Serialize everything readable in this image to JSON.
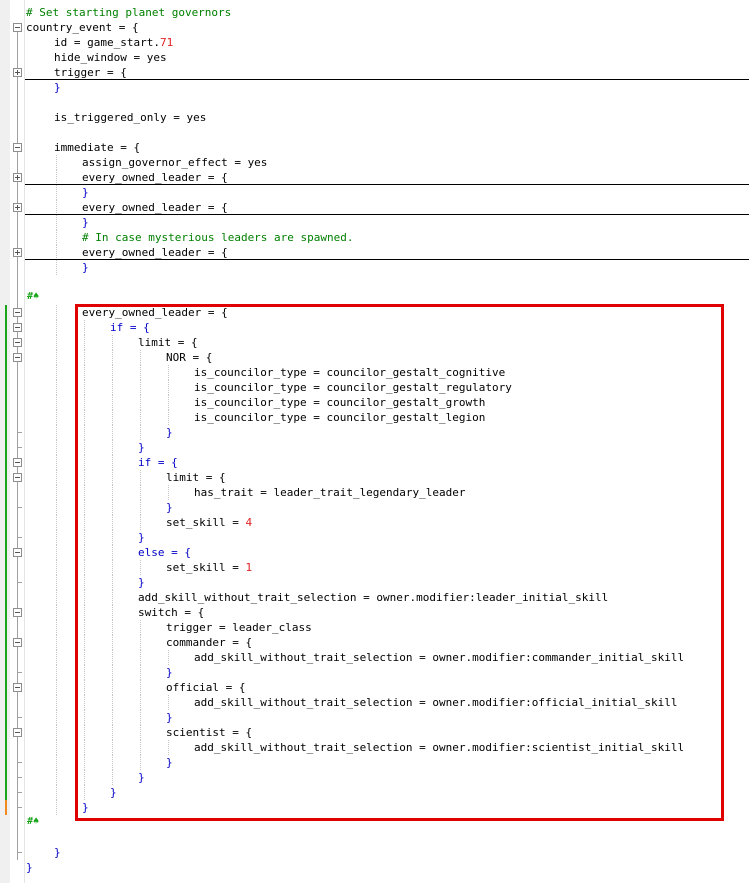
{
  "editor": {
    "lines": [
      {
        "indent": 0,
        "gutter": "none",
        "segments": [
          {
            "text": "# Set starting planet governors",
            "cls": "cmt"
          }
        ]
      },
      {
        "indent": 0,
        "gutter": "fold-open",
        "segments": [
          {
            "text": "country_event = {",
            "cls": "plain"
          }
        ]
      },
      {
        "indent": 1,
        "gutter": "line",
        "segments": [
          {
            "text": "id = game_start.",
            "cls": "plain"
          },
          {
            "text": "71",
            "cls": "num"
          }
        ]
      },
      {
        "indent": 1,
        "gutter": "line",
        "segments": [
          {
            "text": "hide_window = yes",
            "cls": "plain"
          }
        ]
      },
      {
        "indent": 1,
        "gutter": "fold-closed",
        "folded": true,
        "segments": [
          {
            "text": "trigger = {",
            "cls": "plain"
          }
        ]
      },
      {
        "indent": 1,
        "gutter": "line",
        "segments": [
          {
            "text": "}",
            "cls": "kw"
          }
        ]
      },
      {
        "indent": 0,
        "gutter": "line",
        "segments": []
      },
      {
        "indent": 1,
        "gutter": "line",
        "segments": [
          {
            "text": "is_triggered_only = yes",
            "cls": "plain"
          }
        ]
      },
      {
        "indent": 0,
        "gutter": "line",
        "segments": []
      },
      {
        "indent": 1,
        "gutter": "fold-open",
        "segments": [
          {
            "text": "immediate = {",
            "cls": "plain"
          }
        ]
      },
      {
        "indent": 2,
        "gutter": "line",
        "segments": [
          {
            "text": "assign_governor_effect = yes",
            "cls": "plain"
          }
        ]
      },
      {
        "indent": 2,
        "gutter": "fold-closed",
        "folded": true,
        "segments": [
          {
            "text": "every_owned_leader = {",
            "cls": "plain"
          }
        ]
      },
      {
        "indent": 2,
        "gutter": "line",
        "segments": [
          {
            "text": "}",
            "cls": "kw"
          }
        ]
      },
      {
        "indent": 2,
        "gutter": "fold-closed",
        "folded": true,
        "segments": [
          {
            "text": "every_owned_leader = {",
            "cls": "plain"
          }
        ]
      },
      {
        "indent": 2,
        "gutter": "line",
        "segments": [
          {
            "text": "}",
            "cls": "kw"
          }
        ]
      },
      {
        "indent": 2,
        "gutter": "line",
        "segments": [
          {
            "text": "# In case mysterious leaders are spawned.",
            "cls": "cmt"
          }
        ]
      },
      {
        "indent": 2,
        "gutter": "fold-closed",
        "folded": true,
        "segments": [
          {
            "text": "every_owned_leader = {",
            "cls": "plain"
          }
        ]
      },
      {
        "indent": 2,
        "gutter": "line",
        "segments": [
          {
            "text": "}",
            "cls": "kw"
          }
        ]
      },
      {
        "indent": 0,
        "gutter": "line",
        "segments": []
      },
      {
        "indent": 0,
        "gutter": "line",
        "mark": "#♠",
        "segments": []
      },
      {
        "indent": 2,
        "gutter": "fold-open",
        "change": "green",
        "segments": [
          {
            "text": "every_owned_leader = {",
            "cls": "plain"
          }
        ]
      },
      {
        "indent": 3,
        "gutter": "fold-open",
        "change": "green",
        "segments": [
          {
            "text": "if = {",
            "cls": "kw"
          }
        ]
      },
      {
        "indent": 4,
        "gutter": "fold-open",
        "change": "green",
        "segments": [
          {
            "text": "limit = {",
            "cls": "plain"
          }
        ]
      },
      {
        "indent": 5,
        "gutter": "fold-open",
        "change": "green",
        "segments": [
          {
            "text": "NOR = {",
            "cls": "plain"
          }
        ]
      },
      {
        "indent": 6,
        "gutter": "line",
        "change": "green",
        "segments": [
          {
            "text": "is_councilor_type = councilor_gestalt_cognitive",
            "cls": "plain"
          }
        ]
      },
      {
        "indent": 6,
        "gutter": "line",
        "change": "green",
        "segments": [
          {
            "text": "is_councilor_type = councilor_gestalt_regulatory",
            "cls": "plain"
          }
        ]
      },
      {
        "indent": 6,
        "gutter": "line",
        "change": "green",
        "segments": [
          {
            "text": "is_councilor_type = councilor_gestalt_growth",
            "cls": "plain"
          }
        ]
      },
      {
        "indent": 6,
        "gutter": "line",
        "change": "green",
        "segments": [
          {
            "text": "is_councilor_type = councilor_gestalt_legion",
            "cls": "plain"
          }
        ]
      },
      {
        "indent": 5,
        "gutter": "close",
        "change": "green",
        "segments": [
          {
            "text": "}",
            "cls": "kw"
          }
        ]
      },
      {
        "indent": 4,
        "gutter": "close",
        "change": "green",
        "segments": [
          {
            "text": "}",
            "cls": "kw"
          }
        ]
      },
      {
        "indent": 4,
        "gutter": "fold-open",
        "change": "green",
        "segments": [
          {
            "text": "if = {",
            "cls": "kw"
          }
        ]
      },
      {
        "indent": 5,
        "gutter": "fold-open",
        "change": "green",
        "segments": [
          {
            "text": "limit = {",
            "cls": "plain"
          }
        ]
      },
      {
        "indent": 6,
        "gutter": "line",
        "change": "green",
        "segments": [
          {
            "text": "has_trait = leader_trait_legendary_leader",
            "cls": "plain"
          }
        ]
      },
      {
        "indent": 5,
        "gutter": "close",
        "change": "green",
        "segments": [
          {
            "text": "}",
            "cls": "kw"
          }
        ]
      },
      {
        "indent": 5,
        "gutter": "line",
        "change": "green",
        "segments": [
          {
            "text": "set_skill = ",
            "cls": "plain"
          },
          {
            "text": "4",
            "cls": "num"
          }
        ]
      },
      {
        "indent": 4,
        "gutter": "close",
        "change": "green",
        "segments": [
          {
            "text": "}",
            "cls": "kw"
          }
        ]
      },
      {
        "indent": 4,
        "gutter": "fold-open",
        "change": "green",
        "segments": [
          {
            "text": "else = {",
            "cls": "kw"
          }
        ]
      },
      {
        "indent": 5,
        "gutter": "line",
        "change": "green",
        "segments": [
          {
            "text": "set_skill = ",
            "cls": "plain"
          },
          {
            "text": "1",
            "cls": "num"
          }
        ]
      },
      {
        "indent": 4,
        "gutter": "close",
        "change": "green",
        "segments": [
          {
            "text": "}",
            "cls": "kw"
          }
        ]
      },
      {
        "indent": 4,
        "gutter": "line",
        "change": "green",
        "segments": [
          {
            "text": "add_skill_without_trait_selection = owner.modifier:leader_initial_skill",
            "cls": "plain"
          }
        ]
      },
      {
        "indent": 4,
        "gutter": "fold-open",
        "change": "green",
        "segments": [
          {
            "text": "switch = {",
            "cls": "plain"
          }
        ]
      },
      {
        "indent": 5,
        "gutter": "line",
        "change": "green",
        "segments": [
          {
            "text": "trigger = leader_class",
            "cls": "plain"
          }
        ]
      },
      {
        "indent": 5,
        "gutter": "fold-open",
        "change": "green",
        "segments": [
          {
            "text": "commander = {",
            "cls": "plain"
          }
        ]
      },
      {
        "indent": 6,
        "gutter": "line",
        "change": "green",
        "segments": [
          {
            "text": "add_skill_without_trait_selection = owner.modifier:commander_initial_skill",
            "cls": "plain"
          }
        ]
      },
      {
        "indent": 5,
        "gutter": "close",
        "change": "green",
        "segments": [
          {
            "text": "}",
            "cls": "kw"
          }
        ]
      },
      {
        "indent": 5,
        "gutter": "fold-open",
        "change": "green",
        "segments": [
          {
            "text": "official = {",
            "cls": "plain"
          }
        ]
      },
      {
        "indent": 6,
        "gutter": "line",
        "change": "green",
        "segments": [
          {
            "text": "add_skill_without_trait_selection = owner.modifier:official_initial_skill",
            "cls": "plain"
          }
        ]
      },
      {
        "indent": 5,
        "gutter": "close",
        "change": "green",
        "segments": [
          {
            "text": "}",
            "cls": "kw"
          }
        ]
      },
      {
        "indent": 5,
        "gutter": "fold-open",
        "change": "green",
        "segments": [
          {
            "text": "scientist = {",
            "cls": "plain"
          }
        ]
      },
      {
        "indent": 6,
        "gutter": "line",
        "change": "green",
        "segments": [
          {
            "text": "add_skill_without_trait_selection = owner.modifier:scientist_initial_skill",
            "cls": "plain"
          }
        ]
      },
      {
        "indent": 5,
        "gutter": "close",
        "change": "green",
        "segments": [
          {
            "text": "}",
            "cls": "kw"
          }
        ]
      },
      {
        "indent": 4,
        "gutter": "close",
        "change": "green",
        "segments": [
          {
            "text": "}",
            "cls": "kw"
          }
        ]
      },
      {
        "indent": 3,
        "gutter": "close",
        "change": "green",
        "segments": [
          {
            "text": "}",
            "cls": "kw"
          }
        ]
      },
      {
        "indent": 2,
        "gutter": "close",
        "change": "orange",
        "segments": [
          {
            "text": "}",
            "cls": "kw"
          }
        ]
      },
      {
        "indent": 0,
        "gutter": "line",
        "mark": "#♠",
        "segments": []
      },
      {
        "indent": 0,
        "gutter": "line",
        "segments": []
      },
      {
        "indent": 1,
        "gutter": "close",
        "segments": [
          {
            "text": "}",
            "cls": "kw"
          }
        ]
      },
      {
        "indent": 0,
        "gutter": "none",
        "segments": [
          {
            "text": "}",
            "cls": "kw"
          }
        ]
      }
    ],
    "colors": {
      "comment": "#008000",
      "keyword": "#0000c8",
      "number": "#e02020",
      "change_marker_saved": "#1aa51a",
      "change_marker_unsaved": "#f08a1c",
      "highlight_box": "#e10000"
    }
  }
}
